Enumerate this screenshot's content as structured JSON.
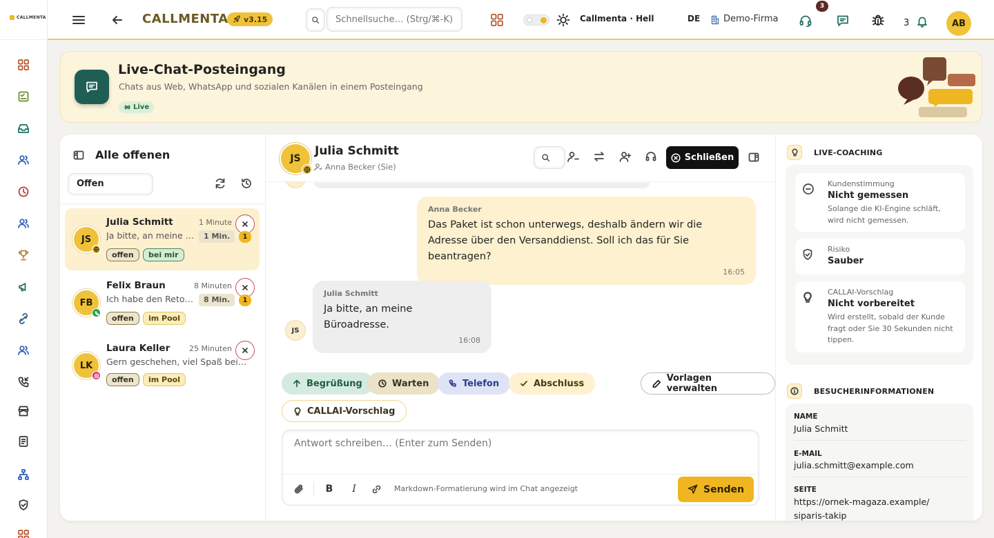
{
  "topbar": {
    "logo": "CALLMENTA",
    "brand": "CALLMENTA",
    "version": "v3.15",
    "search_placeholder": "Schnellsuche… (Strg/⌘-K)",
    "theme_label": "Callmenta · Hell",
    "language": "DE",
    "company": "Demo-Firma",
    "chat_badge": "3",
    "notifications": "3",
    "avatar": "AB"
  },
  "banner": {
    "title": "Live-Chat-Posteingang",
    "subtitle": "Chats aus Web, WhatsApp und sozialen Kanälen in einem Posteingang",
    "live": "Live"
  },
  "inbox": {
    "title": "Alle offenen",
    "filter": "Offen",
    "conversations": [
      {
        "initials": "JS",
        "name": "Julia Schmitt",
        "time": "1 Minute",
        "preview": "Ja bitte, an meine Büroadresse.",
        "wait": "1 Min.",
        "unread": "1",
        "channel": "web",
        "tags": [
          "offen",
          "bei mir"
        ]
      },
      {
        "initials": "FB",
        "name": "Felix Braun",
        "time": "8 Minuten",
        "preview": "Ich habe den Retourenschein erhalten",
        "wait": "8 Min.",
        "unread": "1",
        "channel": "whatsapp",
        "tags": [
          "offen",
          "im Pool"
        ]
      },
      {
        "initials": "LK",
        "name": "Laura Keller",
        "time": "25 Minuten",
        "preview": "Gern geschehen, viel Spaß beim Einkaufen!",
        "wait": "",
        "unread": "",
        "channel": "instagram",
        "tags": [
          "offen",
          "im Pool"
        ]
      }
    ]
  },
  "chat": {
    "initials": "JS",
    "name": "Julia Schmitt",
    "assigned": "Anna Becker (Sie)",
    "close_label": "Schließen",
    "messages": [
      {
        "direction": "out",
        "sender": "Anna Becker",
        "text": "Das Paket ist schon unterwegs, deshalb ändern wir die Adresse über den Versanddienst. Soll ich das für Sie beantragen?",
        "time": "16:05"
      },
      {
        "direction": "in",
        "sender": "Julia Schmitt",
        "initials": "JS",
        "text": "Ja bitte, an meine Büroadresse.",
        "time": "16:08"
      }
    ],
    "quick_replies": [
      "Begrüßung",
      "Warten",
      "Telefon",
      "Abschluss"
    ],
    "manage_templates": "Vorlagen verwalten",
    "ai_suggestion": "CALLAI-Vorschlag",
    "reply_placeholder": "Antwort schreiben… (Enter zum Senden)",
    "format_hint": "Markdown-Formatierung wird im Chat angezeigt",
    "send_label": "Senden"
  },
  "coaching": {
    "title": "LIVE-COACHING",
    "cards": [
      {
        "label": "Kundenstimmung",
        "value": "Nicht gemessen",
        "desc": "Solange die KI-Engine schläft, wird nicht gemessen."
      },
      {
        "label": "Risiko",
        "value": "Sauber",
        "desc": ""
      },
      {
        "label": "CALLAI-Vorschlag",
        "value": "Nicht vorbereitet",
        "desc": "Wird erstellt, sobald der Kunde fragt oder Sie 30 Sekunden nicht tippen."
      }
    ]
  },
  "visitor": {
    "title": "BESUCHERINFORMATIONEN",
    "fields": [
      {
        "label": "NAME",
        "value": "Julia Schmitt"
      },
      {
        "label": "E-MAIL",
        "value": "julia.schmitt@example.com"
      },
      {
        "label": "SEITE",
        "value": "https://ornek-magaza.example/siparis-takip"
      }
    ]
  },
  "colors": {
    "accent": "#f0b621",
    "brand_text": "#6b5a23",
    "banner_bg": "#fdf4dc",
    "icon_teal": "#1f5e54",
    "close_btn": "#111111"
  }
}
